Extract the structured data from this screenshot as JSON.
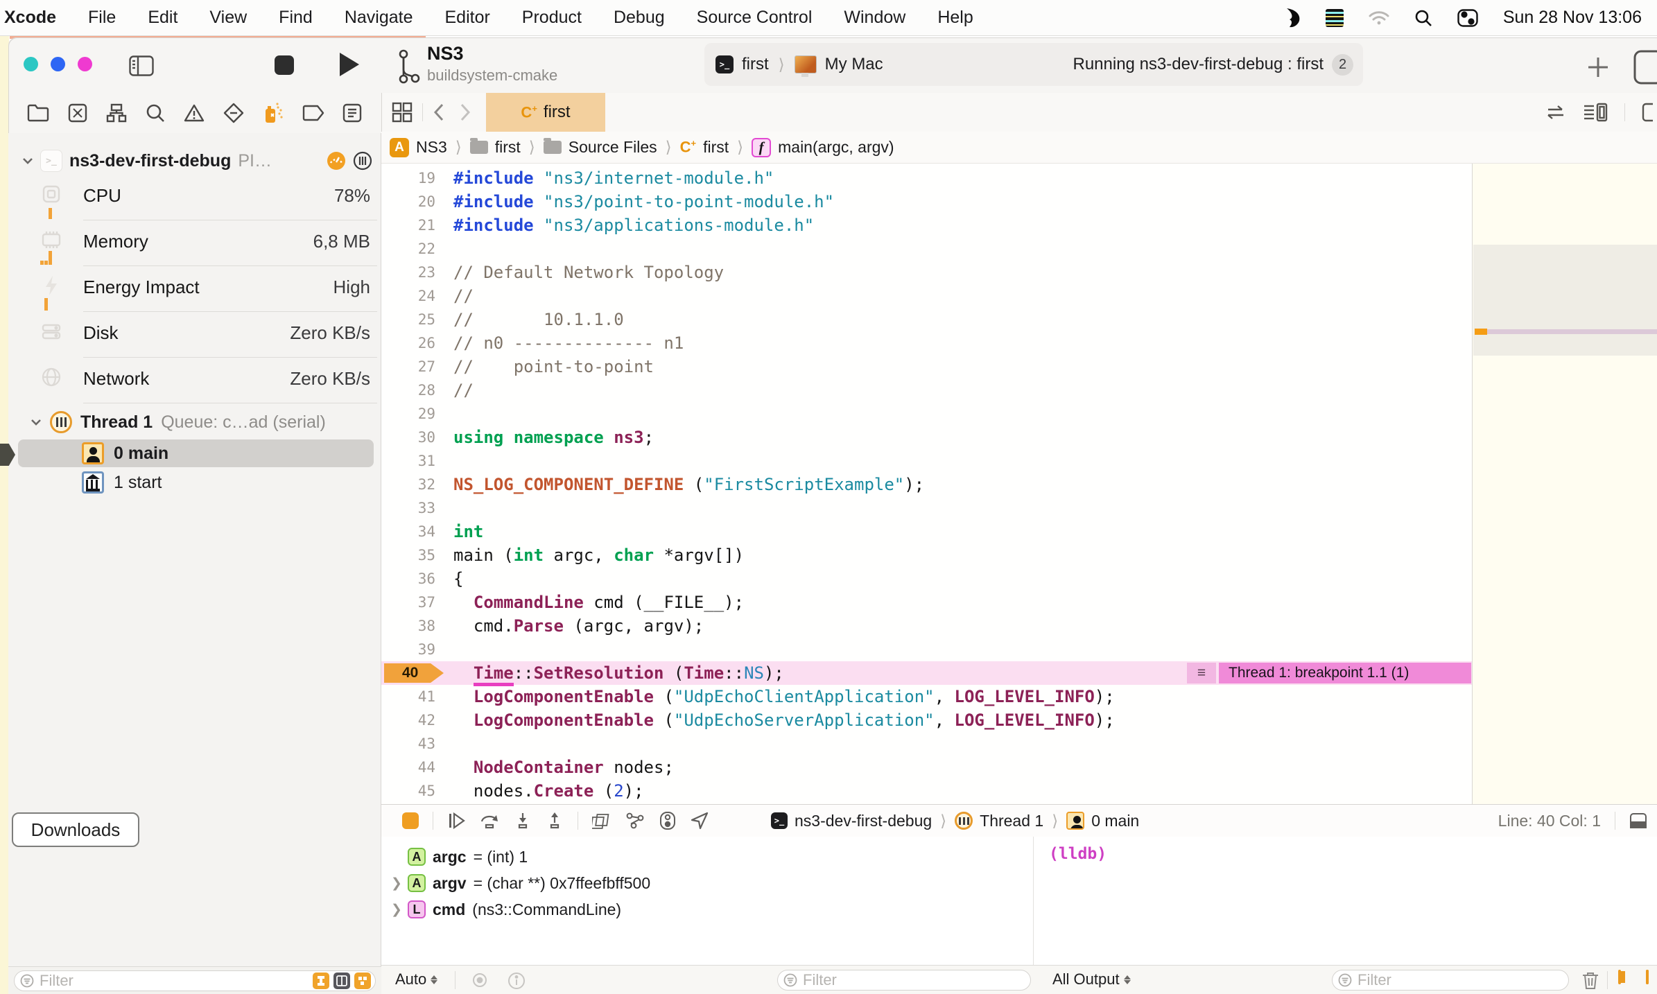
{
  "menu_bar": {
    "app": "Xcode",
    "items": [
      "File",
      "Edit",
      "View",
      "Find",
      "Navigate",
      "Editor",
      "Product",
      "Debug",
      "Source Control",
      "Window",
      "Help"
    ],
    "clock": "Sun 28 Nov 13:06"
  },
  "toolbar": {
    "scheme_name": "NS3",
    "scheme_subtitle": "buildsystem-cmake",
    "target": "first",
    "destination": "My Mac",
    "status": "Running ns3-dev-first-debug : first",
    "status_badge": "2"
  },
  "tab_bar": {
    "active_tab": "first",
    "file_type_icon": "C",
    "file_type_sup": "+"
  },
  "jump_bar": {
    "project": "NS3",
    "group": "first",
    "subgroup": "Source Files",
    "file": "first",
    "symbol": "main(argc, argv)"
  },
  "sidebar": {
    "process": {
      "name": "ns3-dev-first-debug",
      "suffix": "PI…"
    },
    "gauges": [
      {
        "label": "CPU",
        "value": "78%"
      },
      {
        "label": "Memory",
        "value": "6,8 MB"
      },
      {
        "label": "Energy Impact",
        "value": "High"
      },
      {
        "label": "Disk",
        "value": "Zero KB/s"
      },
      {
        "label": "Network",
        "value": "Zero KB/s"
      }
    ],
    "thread": {
      "name": "Thread 1",
      "queue": "Queue: c…ad (serial)"
    },
    "frames": [
      {
        "label": "0 main"
      },
      {
        "label": "1 start"
      }
    ],
    "downloads_label": "Downloads",
    "filter_placeholder": "Filter"
  },
  "editor": {
    "breakpoint": {
      "line": 40,
      "label": "Thread 1: breakpoint 1.1 (1)"
    },
    "code": {
      "lines": [
        [
          19,
          [
            [
              "dir",
              "#include"
            ],
            [
              "pl",
              " "
            ],
            [
              "str",
              "\"ns3/internet-module.h\""
            ]
          ]
        ],
        [
          20,
          [
            [
              "dir",
              "#include"
            ],
            [
              "pl",
              " "
            ],
            [
              "str",
              "\"ns3/point-to-point-module.h\""
            ]
          ]
        ],
        [
          21,
          [
            [
              "dir",
              "#include"
            ],
            [
              "pl",
              " "
            ],
            [
              "str",
              "\"ns3/applications-module.h\""
            ]
          ]
        ],
        [
          22,
          []
        ],
        [
          23,
          [
            [
              "com",
              "// Default Network Topology"
            ]
          ]
        ],
        [
          24,
          [
            [
              "com",
              "//"
            ]
          ]
        ],
        [
          25,
          [
            [
              "com",
              "//       10.1.1.0"
            ]
          ]
        ],
        [
          26,
          [
            [
              "com",
              "// n0 -------------- n1"
            ]
          ]
        ],
        [
          27,
          [
            [
              "com",
              "//    point-to-point"
            ]
          ]
        ],
        [
          28,
          [
            [
              "com",
              "//"
            ]
          ]
        ],
        [
          29,
          []
        ],
        [
          30,
          [
            [
              "kw",
              "using"
            ],
            [
              "pl",
              " "
            ],
            [
              "kw",
              "namespace"
            ],
            [
              "pl",
              " "
            ],
            [
              "typ",
              "ns3"
            ],
            [
              "pl",
              ";"
            ]
          ]
        ],
        [
          31,
          []
        ],
        [
          32,
          [
            [
              "mac",
              "NS_LOG_COMPONENT_DEFINE"
            ],
            [
              "pl",
              " ("
            ],
            [
              "str",
              "\"FirstScriptExample\""
            ],
            [
              "pl",
              ");"
            ]
          ]
        ],
        [
          33,
          []
        ],
        [
          34,
          [
            [
              "kw",
              "int"
            ]
          ]
        ],
        [
          35,
          [
            [
              "pl",
              "main ("
            ],
            [
              "kw",
              "int"
            ],
            [
              "pl",
              " argc, "
            ],
            [
              "kw",
              "char"
            ],
            [
              "pl",
              " *argv[])"
            ]
          ]
        ],
        [
          36,
          [
            [
              "pl",
              "{"
            ]
          ]
        ],
        [
          37,
          [
            [
              "pl",
              "  "
            ],
            [
              "typ",
              "CommandLine"
            ],
            [
              "pl",
              " cmd (__FILE__);"
            ]
          ]
        ],
        [
          38,
          [
            [
              "pl",
              "  cmd."
            ],
            [
              "typ",
              "Parse"
            ],
            [
              "pl",
              " (argc, argv);"
            ]
          ]
        ],
        [
          39,
          []
        ],
        [
          40,
          [
            [
              "pl",
              "  "
            ],
            [
              "typu",
              "Time"
            ],
            [
              "pl",
              "::"
            ],
            [
              "typ",
              "SetResolution"
            ],
            [
              "pl",
              " ("
            ],
            [
              "typ",
              "Time"
            ],
            [
              "pl",
              "::"
            ],
            [
              "enm",
              "NS"
            ],
            [
              "pl",
              ");"
            ]
          ]
        ],
        [
          41,
          [
            [
              "pl",
              "  "
            ],
            [
              "typ",
              "LogComponentEnable"
            ],
            [
              "pl",
              " ("
            ],
            [
              "str",
              "\"UdpEchoClientApplication\""
            ],
            [
              "pl",
              ", "
            ],
            [
              "typ",
              "LOG_LEVEL_INFO"
            ],
            [
              "pl",
              ");"
            ]
          ]
        ],
        [
          42,
          [
            [
              "pl",
              "  "
            ],
            [
              "typ",
              "LogComponentEnable"
            ],
            [
              "pl",
              " ("
            ],
            [
              "str",
              "\"UdpEchoServerApplication\""
            ],
            [
              "pl",
              ", "
            ],
            [
              "typ",
              "LOG_LEVEL_INFO"
            ],
            [
              "pl",
              ");"
            ]
          ]
        ],
        [
          43,
          []
        ],
        [
          44,
          [
            [
              "pl",
              "  "
            ],
            [
              "typ",
              "NodeContainer"
            ],
            [
              "pl",
              " nodes;"
            ]
          ]
        ],
        [
          45,
          [
            [
              "pl",
              "  nodes."
            ],
            [
              "typ",
              "Create"
            ],
            [
              "pl",
              " ("
            ],
            [
              "num",
              "2"
            ],
            [
              "pl",
              ");"
            ]
          ]
        ]
      ]
    }
  },
  "debug": {
    "process": "ns3-dev-first-debug",
    "thread": "Thread 1",
    "frame": "0 main",
    "line_col": "Line: 40  Col: 1",
    "variables": [
      {
        "badge": "A",
        "name": "argc",
        "value": "= (int) 1"
      },
      {
        "badge": "A",
        "name": "argv",
        "value": "= (char **) 0x7ffeefbff500"
      },
      {
        "badge": "L",
        "name": "cmd",
        "value": "(ns3::CommandLine)"
      }
    ],
    "console_prompt": "(lldb)",
    "scope_selector": "Auto",
    "output_selector": "All Output",
    "variables_filter_placeholder": "Filter",
    "console_filter_placeholder": "Filter"
  },
  "colors": {
    "accent_orange": "#f0a32a",
    "breakpoint_pink": "#f08ad8",
    "line_highlight": "#fbdef1",
    "tab_selected": "#f3d09e"
  }
}
